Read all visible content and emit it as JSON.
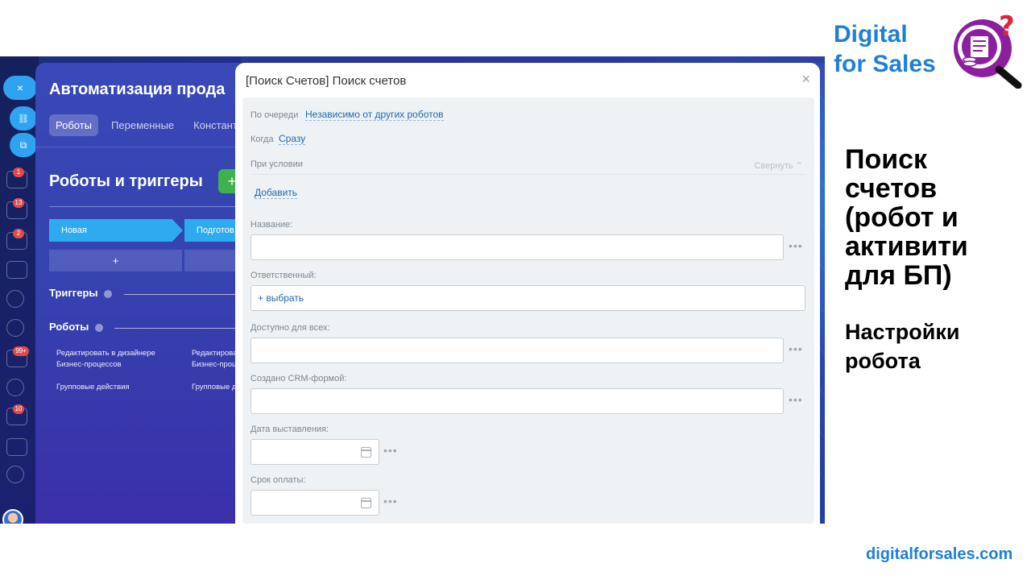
{
  "slide": {
    "brand_line1": "Digital",
    "brand_line2": "for Sales",
    "heading_lines": [
      "Поиск",
      "счетов",
      "(робот и",
      "активити",
      "для БП)"
    ],
    "subheading_lines": [
      "Настройки",
      "робота"
    ],
    "website": "digitalforsales.com",
    "colors": {
      "brand_blue": "#1f7fd6",
      "logo_purple": "#8b1fa0",
      "logo_red": "#e0243a"
    }
  },
  "nav": {
    "badges": [
      "1",
      "13",
      "2",
      "99+",
      "10"
    ],
    "pills": [
      {
        "icon": "close-icon",
        "glyph": "×"
      },
      {
        "icon": "link-icon",
        "glyph": "🔗"
      },
      {
        "icon": "open-external-icon",
        "glyph": "⧉"
      }
    ]
  },
  "automation": {
    "title": "Автоматизация прода",
    "tabs": [
      {
        "label": "Роботы",
        "active": true
      },
      {
        "label": "Переменные",
        "active": false
      },
      {
        "label": "Констант",
        "active": false
      }
    ],
    "section_title": "Роботы и триггеры",
    "add_glyph": "+",
    "stages": [
      "Новая",
      "Подготов"
    ],
    "plus_glyph": "+",
    "triggers_label": "Триггеры",
    "robots_label": "Роботы",
    "links": [
      [
        "Редактировать в дизайнере",
        "Бизнес-процессов"
      ],
      [
        "Редактирова",
        "Бизнес-проц"
      ],
      [
        "Групповые действия"
      ],
      [
        "Групповые д"
      ]
    ]
  },
  "modal": {
    "title": "[Поиск Счетов] Поиск счетов",
    "close_glyph": "×",
    "queue_label": "По очереди",
    "queue_value": "Независимо от других роботов",
    "when_label": "Когда",
    "when_value": "Сразу",
    "condition_label": "При условии",
    "collapse_label": "Свернуть ⌃",
    "add_label": "Добавить",
    "fields": {
      "name_label": "Название:",
      "responsible_label": "Ответственный:",
      "responsible_value": "+ выбрать",
      "available_label": "Доступно для всех:",
      "crm_label": "Создано CRM-формой:",
      "date_label": "Дата выставления:",
      "due_label": "Срок оплаты:"
    },
    "more_glyph": "•••"
  }
}
